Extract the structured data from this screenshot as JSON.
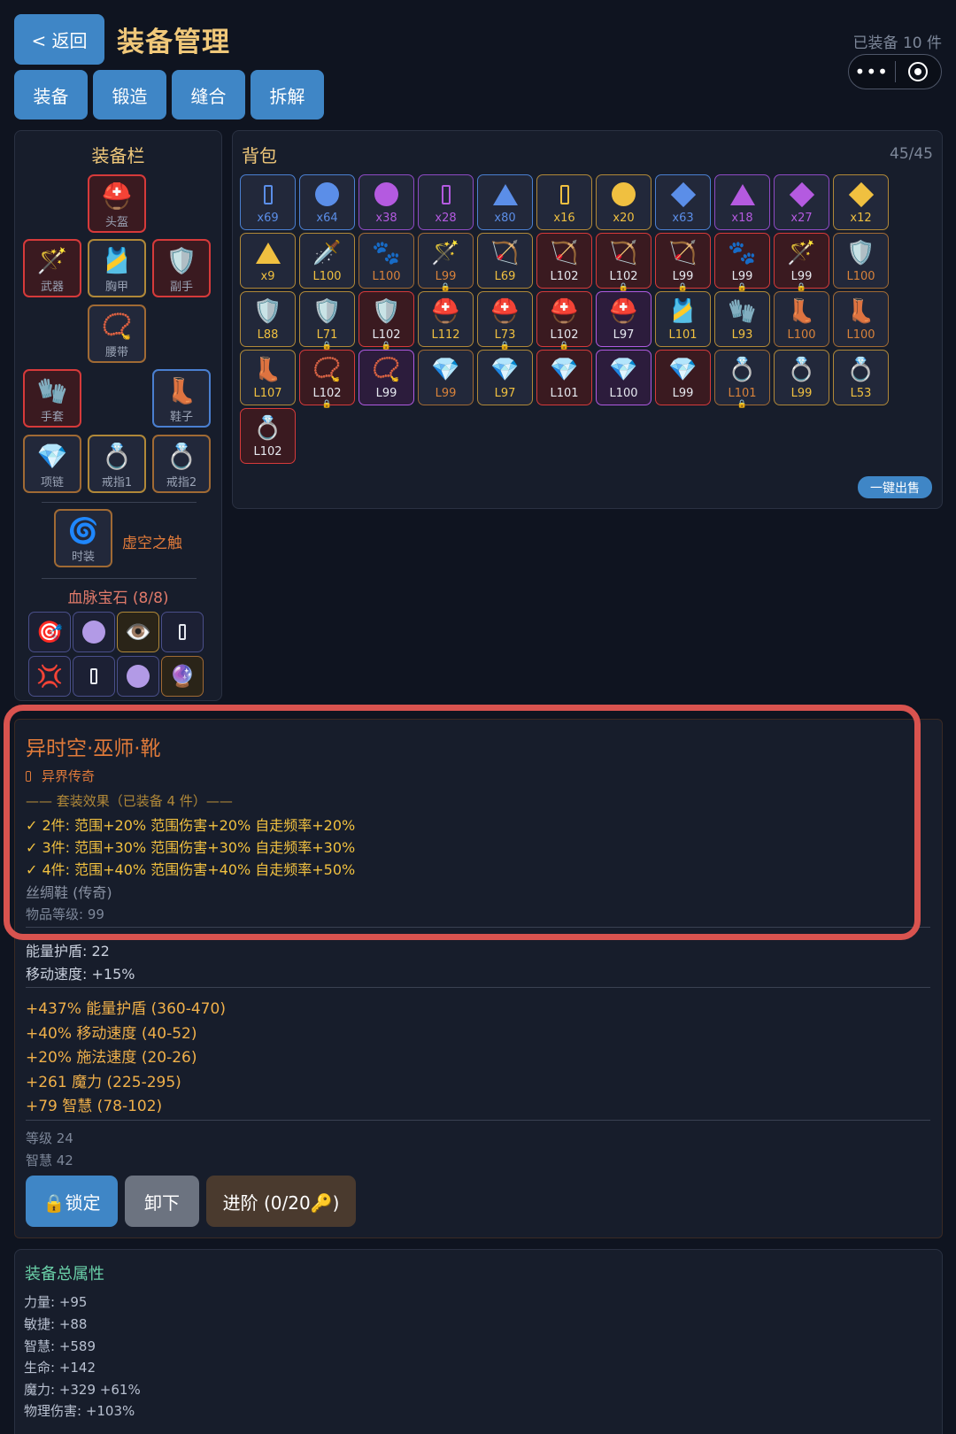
{
  "header": {
    "back_label": "< 返回",
    "title": "装备管理",
    "equipped_count": "已装备 10 件",
    "tabs": [
      "装备",
      "锻造",
      "缝合",
      "拆解"
    ]
  },
  "equipment_panel": {
    "title": "装备栏",
    "slots": {
      "helmet": "头盔",
      "weapon": "武器",
      "chest": "胸甲",
      "offhand": "副手",
      "belt": "腰带",
      "gloves": "手套",
      "boots": "鞋子",
      "necklace": "项链",
      "ring1": "戒指1",
      "ring2": "戒指2",
      "fashion": "时装"
    },
    "fashion_name": "虚空之触",
    "gems_title": "血脉宝石 (8/8)"
  },
  "bag": {
    "title": "背包",
    "capacity": "45/45",
    "sell_all": "一键出售",
    "items": [
      {
        "icon": "rect",
        "color": "blue",
        "label": "x69"
      },
      {
        "icon": "circle",
        "color": "blue",
        "label": "x64"
      },
      {
        "icon": "circle",
        "color": "purple",
        "label": "x38"
      },
      {
        "icon": "rect",
        "color": "purple",
        "label": "x28"
      },
      {
        "icon": "tri",
        "color": "blue",
        "label": "x80"
      },
      {
        "icon": "rect",
        "color": "gold",
        "label": "x16"
      },
      {
        "icon": "circle",
        "color": "gold",
        "label": "x20"
      },
      {
        "icon": "diamond",
        "color": "blue",
        "label": "x63"
      },
      {
        "icon": "tri",
        "color": "purple",
        "label": "x18"
      },
      {
        "icon": "diamond",
        "color": "purple",
        "label": "x27"
      },
      {
        "icon": "diamond",
        "color": "gold",
        "label": "x12"
      },
      {
        "icon": "tri",
        "color": "gold",
        "label": "x9"
      },
      {
        "icon": "🗡️",
        "color": "gold",
        "label": "L100"
      },
      {
        "icon": "🐾",
        "color": "orange",
        "label": "L100"
      },
      {
        "icon": "🪄",
        "color": "orange",
        "label": "L99",
        "lock": true
      },
      {
        "icon": "🏹",
        "color": "gold",
        "label": "L69"
      },
      {
        "icon": "🏹",
        "color": "red",
        "label": "L102"
      },
      {
        "icon": "🏹",
        "color": "red",
        "label": "L102",
        "lock": true
      },
      {
        "icon": "🏹",
        "color": "red",
        "label": "L99",
        "lock": true
      },
      {
        "icon": "🐾",
        "color": "red",
        "label": "L99",
        "lock": true
      },
      {
        "icon": "🪄",
        "color": "red",
        "label": "L99",
        "lock": true
      },
      {
        "icon": "🛡️",
        "color": "orange",
        "label": "L100"
      },
      {
        "icon": "🛡️",
        "color": "gold",
        "label": "L88"
      },
      {
        "icon": "🛡️",
        "color": "gold",
        "label": "L71",
        "lock": true
      },
      {
        "icon": "🛡️",
        "color": "red",
        "label": "L102",
        "lock": true
      },
      {
        "icon": "⛑️",
        "color": "gold",
        "label": "L112"
      },
      {
        "icon": "⛑️",
        "color": "gold",
        "label": "L73",
        "lock": true
      },
      {
        "icon": "⛑️",
        "color": "red",
        "label": "L102",
        "lock": true
      },
      {
        "icon": "⛑️",
        "color": "violet",
        "label": "L97"
      },
      {
        "icon": "🎽",
        "color": "gold",
        "label": "L101"
      },
      {
        "icon": "🧤",
        "color": "gold",
        "label": "L93"
      },
      {
        "icon": "👢",
        "color": "orange",
        "label": "L100"
      },
      {
        "icon": "👢",
        "color": "orange",
        "label": "L100"
      },
      {
        "icon": "👢",
        "color": "gold",
        "label": "L107"
      },
      {
        "icon": "📿",
        "color": "red",
        "label": "L102",
        "lock": true
      },
      {
        "icon": "📿",
        "color": "violet",
        "label": "L99"
      },
      {
        "icon": "💎",
        "color": "orange",
        "label": "L99"
      },
      {
        "icon": "💎",
        "color": "gold",
        "label": "L97"
      },
      {
        "icon": "💎",
        "color": "red",
        "label": "L101"
      },
      {
        "icon": "💎",
        "color": "violet",
        "label": "L100"
      },
      {
        "icon": "💎",
        "color": "red",
        "label": "L99"
      },
      {
        "icon": "💍",
        "color": "orange",
        "label": "L101",
        "lock": true
      },
      {
        "icon": "💍",
        "color": "gold",
        "label": "L99"
      },
      {
        "icon": "💍",
        "color": "gold",
        "label": "L53"
      },
      {
        "icon": "💍",
        "color": "red",
        "label": "L102"
      }
    ]
  },
  "detail": {
    "name": "异时空·巫师·靴",
    "rarity_icon": "rect",
    "rarity": "异界传奇",
    "set_header": "—— 套装效果（已装备 4 件）——",
    "set_effects": [
      "✓ 2件:  范围+20%  范围伤害+20%  自走频率+20%",
      "✓ 3件:  范围+30%  范围伤害+30%  自走频率+30%",
      "✓ 4件:  范围+40%  范围伤害+40%  自走频率+50%"
    ],
    "base_item": "丝绸鞋 (传奇)",
    "item_level": "物品等级: 99",
    "base_stats": [
      "能量护盾: 22",
      "移动速度: +15%"
    ],
    "affixes": [
      "+437% 能量护盾 (360-470)",
      "+40% 移动速度 (40-52)",
      "+20% 施法速度 (20-26)",
      "+261 魔力 (225-295)",
      "+79 智慧 (78-102)"
    ],
    "requirements": [
      "等级 24",
      "智慧 42"
    ],
    "buttons": {
      "lock": "🔒锁定",
      "unequip": "卸下",
      "upgrade": "进阶 (0/20🔑)"
    }
  },
  "totals": {
    "title": "装备总属性",
    "stats": [
      "力量: +95",
      "敏捷: +88",
      "智慧: +589",
      "生命: +142",
      "魔力: +329  +61%",
      "物理伤害: +103%"
    ]
  },
  "colors": {
    "accent": "#3f86c6",
    "title_gold": "#f0c87a",
    "legendary_orange": "#e07a3a",
    "highlight_red": "#d9534f"
  }
}
